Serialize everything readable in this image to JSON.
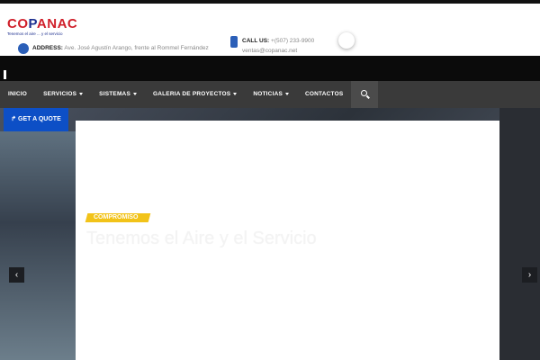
{
  "brand": {
    "logo_prefix": "CO",
    "logo_mid": "P",
    "logo_suffix": "ANAC",
    "tagline": "Tenemos el aire ... y el servicio"
  },
  "contact": {
    "address_label": "ADDRESS:",
    "address_value": "Ave. José Agustín Arango, frente al Rommel Fernández",
    "call_label": "CALL US:",
    "call_value": "+(507) 233-9900",
    "email": "ventas@copanac.net"
  },
  "nav": {
    "items": [
      {
        "label": "INICIO",
        "dropdown": false
      },
      {
        "label": "SERVICIOS",
        "dropdown": true
      },
      {
        "label": "SISTEMAS",
        "dropdown": true
      },
      {
        "label": "GALERIA DE PROYECTOS",
        "dropdown": true
      },
      {
        "label": "NOTICIAS",
        "dropdown": true
      },
      {
        "label": "CONTACTOS",
        "dropdown": false
      }
    ],
    "search_icon": "search-icon"
  },
  "quote_button": {
    "icon": "share-icon",
    "label": "GET A QUOTE"
  },
  "slider": {
    "badge": "COMPROMISO",
    "headline": "Tenemos el Aire y el Servicio",
    "prev_icon": "chevron-left-icon",
    "next_icon": "chevron-right-icon"
  },
  "colors": {
    "brand_red": "#d01f2a",
    "brand_blue": "#1d2f8f",
    "accent_blue": "#0d4fc6",
    "badge_yellow": "#f2c319",
    "nav_bg": "#3a3a3a"
  }
}
